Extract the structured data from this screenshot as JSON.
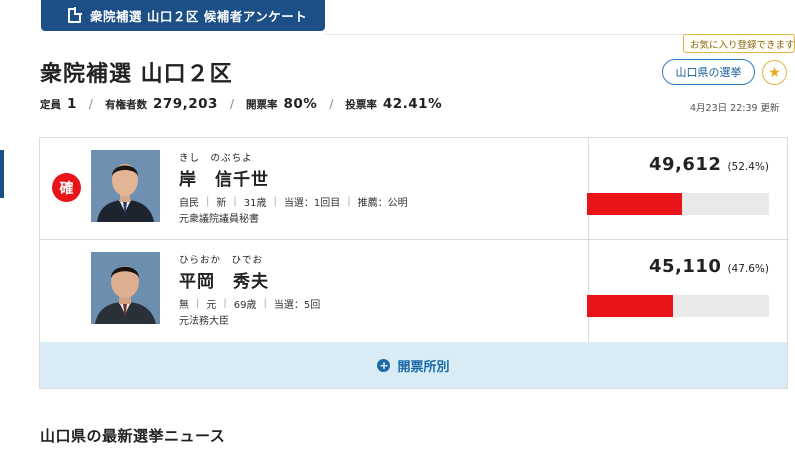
{
  "header": {
    "survey_button": "衆院補選 山口２区 候補者アンケート",
    "title": "衆院補選 山口２区",
    "favorite_tooltip": "お気に入り登録できます",
    "prefecture_button": "山口県の選挙",
    "updated": "4月23日 22:39 更新"
  },
  "stats": {
    "seats_label": "定員",
    "seats": "1",
    "voters_label": "有権者数",
    "voters": "279,203",
    "counted_label": "開票率",
    "counted": "80%",
    "turnout_label": "投票率",
    "turnout": "42.41%"
  },
  "candidates": [
    {
      "confirmed_badge": "確",
      "kana": "きし　のぶちよ",
      "name": "岸　信千世",
      "party": "自民",
      "status": "新",
      "age": "31歳",
      "wins": "当選：1回目",
      "endorsement": "推薦：公明",
      "career": "元衆議院議員秘書",
      "votes": "49,612",
      "percent": "(52.4%)",
      "share": 0.524,
      "bar_color": "#e8141a"
    },
    {
      "kana": "ひらおか　ひでお",
      "name": "平岡　秀夫",
      "party": "無",
      "status": "元",
      "age": "69歳",
      "wins": "当選：5回",
      "career": "元法務大臣",
      "votes": "45,110",
      "percent": "(47.6%)",
      "share": 0.476,
      "bar_color": "#e8141a"
    }
  ],
  "breakdown_button": "開票所別",
  "news_heading": "山口県の最新選挙ニュース",
  "icons": {
    "survey": "document-icon",
    "favorite": "star-icon",
    "breakdown": "plus-circle-icon"
  }
}
